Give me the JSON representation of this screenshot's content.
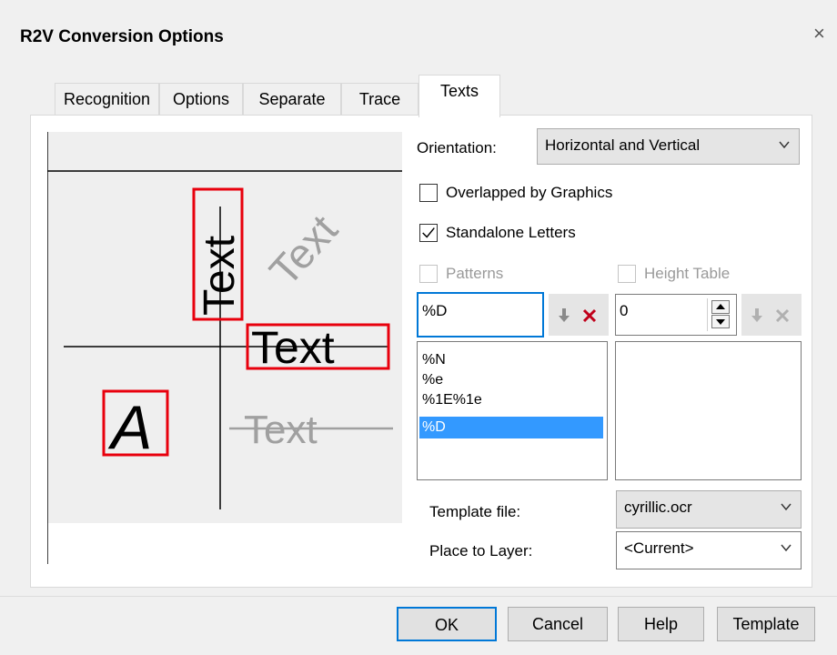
{
  "window": {
    "title": "R2V Conversion Options",
    "close_glyph": "×"
  },
  "tabs": [
    {
      "label": "Recognition"
    },
    {
      "label": "Options"
    },
    {
      "label": "Separate"
    },
    {
      "label": "Trace"
    },
    {
      "label": "Texts",
      "active": true
    }
  ],
  "preview": {
    "sample_word": "Text",
    "sample_letter": "A",
    "colors": {
      "highlight_box": "#e8000d",
      "gray_text": "#a0a0a0"
    }
  },
  "orientation": {
    "label": "Orientation:",
    "value": "Horizontal and Vertical"
  },
  "overlapped": {
    "label": "Overlapped by Graphics",
    "checked": false
  },
  "standalone": {
    "label": "Standalone Letters",
    "checked": true
  },
  "patterns": {
    "label": "Patterns",
    "enabled": false,
    "input_value": "%D",
    "items": [
      "%N",
      "%e",
      "%1E%1e",
      "%D"
    ],
    "selected": "%D"
  },
  "height_table": {
    "label": "Height Table",
    "enabled": false,
    "input_value": "0",
    "items": []
  },
  "template_file": {
    "label": "Template file:",
    "value": "cyrillic.ocr"
  },
  "place_to_layer": {
    "label": "Place to Layer:",
    "value": "<Current>"
  },
  "buttons": {
    "ok": "OK",
    "cancel": "Cancel",
    "help": "Help",
    "template": "Template"
  },
  "colors": {
    "accent": "#0078d7",
    "selection": "#3399ff",
    "delete_red": "#c0001a"
  }
}
